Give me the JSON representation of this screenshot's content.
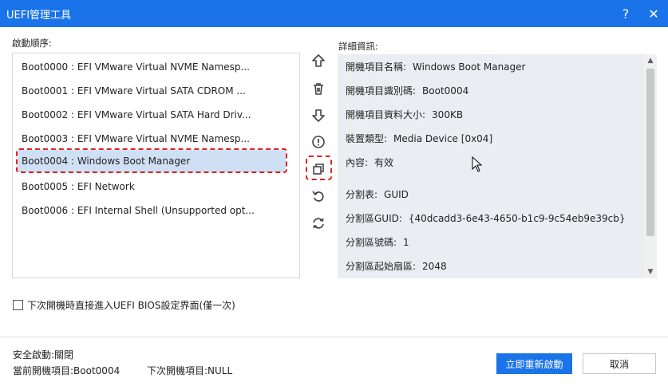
{
  "window": {
    "title": "UEFI管理工具",
    "help_label": "?",
    "close_label": "✕"
  },
  "boot_order": {
    "label": "啟動順序:",
    "items": [
      {
        "label": "Boot0000 : EFI VMware Virtual NVME Namesp...",
        "selected": false
      },
      {
        "label": "Boot0001 : EFI VMware Virtual SATA CDROM ...",
        "selected": false
      },
      {
        "label": "Boot0002 : EFI VMware Virtual SATA Hard Driv...",
        "selected": false
      },
      {
        "label": "Boot0003 : EFI VMware Virtual NVME Namesp...",
        "selected": false
      },
      {
        "label": "Boot0004 : Windows Boot Manager",
        "selected": true
      },
      {
        "label": "Boot0005 : EFI Network",
        "selected": false
      },
      {
        "label": "Boot0006 : EFI Internal Shell (Unsupported opt...",
        "selected": false
      }
    ]
  },
  "side_buttons": [
    "move-up-icon",
    "delete-icon",
    "move-down-icon",
    "info-icon",
    "copy-icon",
    "undo-icon",
    "refresh-icon"
  ],
  "details": {
    "label": "詳細資訊:",
    "rows": [
      {
        "key": "開機項目名稱:",
        "value": "Windows Boot Manager"
      },
      {
        "key": "開機項目識別碼:",
        "value": "Boot0004"
      },
      {
        "key": "開機項目資料大小:",
        "value": "300KB"
      },
      {
        "key": "裝置類型:",
        "value": "Media Device [0x04]"
      },
      {
        "key": "內容:",
        "value": "有效"
      },
      {
        "key": "分割表:",
        "value": "GUID"
      },
      {
        "key": "分割區GUID:",
        "value": "{40dcadd3-6e43-4650-b1c9-9c54eb9e39cb}"
      },
      {
        "key": "分割區號碼:",
        "value": "1"
      },
      {
        "key": "分割區起始扇區:",
        "value": "2048"
      }
    ]
  },
  "option": {
    "checkbox_label": "下次開機時直接進入UEFI BIOS設定界面(僅一次)",
    "checked": false
  },
  "status": {
    "secure_boot_label": "安全啟動:",
    "secure_boot_value": "關閉",
    "current_label": "當前開機項目:",
    "current_value": "Boot0004",
    "next_label": "下次開機項目:",
    "next_value": "NULL"
  },
  "buttons": {
    "restart_label": "立即重新啟動",
    "cancel_label": "取消"
  },
  "colors": {
    "accent": "#1a73e8",
    "selection": "#cfe0f4",
    "highlight_outline": "#e02020"
  }
}
